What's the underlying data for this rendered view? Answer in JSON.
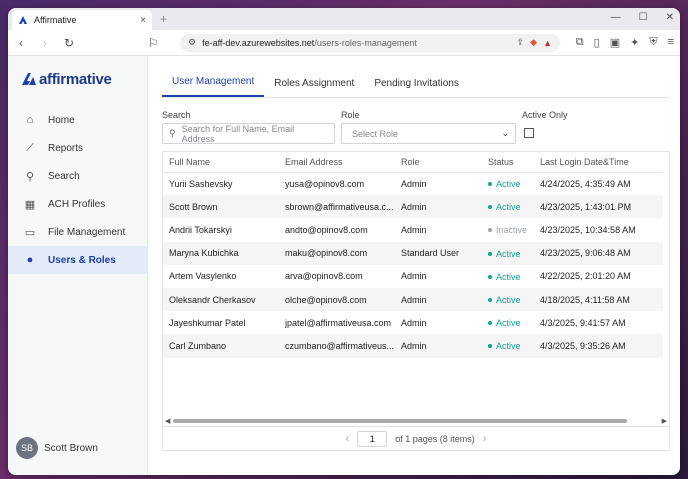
{
  "browser": {
    "tab_title": "Affirmative",
    "tab_close": "×",
    "new_tab": "+",
    "window_controls": [
      "—",
      "☐",
      "✕"
    ],
    "url_host": "fe-aff-dev.azurewebsites.net",
    "url_path": "/users-roles-management"
  },
  "brand": {
    "name": "affirmative",
    "color": "#1e3a8a"
  },
  "sidebar": {
    "items": [
      {
        "label": "Home",
        "icon": "home-icon",
        "glyph": "⌂"
      },
      {
        "label": "Reports",
        "icon": "chart-icon",
        "glyph": "⟋"
      },
      {
        "label": "Search",
        "icon": "search-icon",
        "glyph": "⚲"
      },
      {
        "label": "ACH Profiles",
        "icon": "building-icon",
        "glyph": "▦"
      },
      {
        "label": "File Management",
        "icon": "file-icon",
        "glyph": "▭"
      },
      {
        "label": "Users & Roles",
        "icon": "users-icon",
        "glyph": "●"
      }
    ],
    "active_index": 5,
    "user": {
      "initials": "SB",
      "name": "Scott Brown"
    }
  },
  "tabs": [
    "User Management",
    "Roles Assignment",
    "Pending Invitations"
  ],
  "filters": {
    "search_label": "Search",
    "search_placeholder": "Search for Full Name, Email Address",
    "role_label": "Role",
    "role_placeholder": "Select Role",
    "active_only_label": "Active Only"
  },
  "table": {
    "columns": [
      "Full Name",
      "Email Address",
      "Role",
      "Status",
      "Last Login Date&Time"
    ],
    "rows": [
      [
        "Yurii Sashevsky",
        "yusa@opinov8.com",
        "Admin",
        "Active",
        "4/24/2025, 4:35:49 AM"
      ],
      [
        "Scott Brown",
        "sbrown@affirmativeusa.c...",
        "Admin",
        "Active",
        "4/23/2025, 1:43:01 PM"
      ],
      [
        "Andrii Tokarskyi",
        "andto@opinov8.com",
        "Admin",
        "Inactive",
        "4/23/2025, 10:34:58 AM"
      ],
      [
        "Maryna Kubichka",
        "maku@opinov8.com",
        "Standard User",
        "Active",
        "4/23/2025, 9:06:48 AM"
      ],
      [
        "Artem Vasylenko",
        "arva@opinov8.com",
        "Admin",
        "Active",
        "4/22/2025, 2:01:20 AM"
      ],
      [
        "Oleksandr Cherkasov",
        "olche@opinov8.com",
        "Admin",
        "Active",
        "4/18/2025, 4:11:58 AM"
      ],
      [
        "Jayeshkumar Patel",
        "jpatel@affirmativeusa.com",
        "Admin",
        "Active",
        "4/3/2025, 9:41:57 AM"
      ],
      [
        "Carl Zumbano",
        "czumbano@affirmativeus...",
        "Admin",
        "Active",
        "4/3/2025, 9:35:26 AM"
      ]
    ],
    "status_colors": {
      "Active": "#16a394",
      "Inactive": "#9ca3af"
    }
  },
  "pager": {
    "page": "1",
    "summary": "of 1 pages (8 items)"
  }
}
